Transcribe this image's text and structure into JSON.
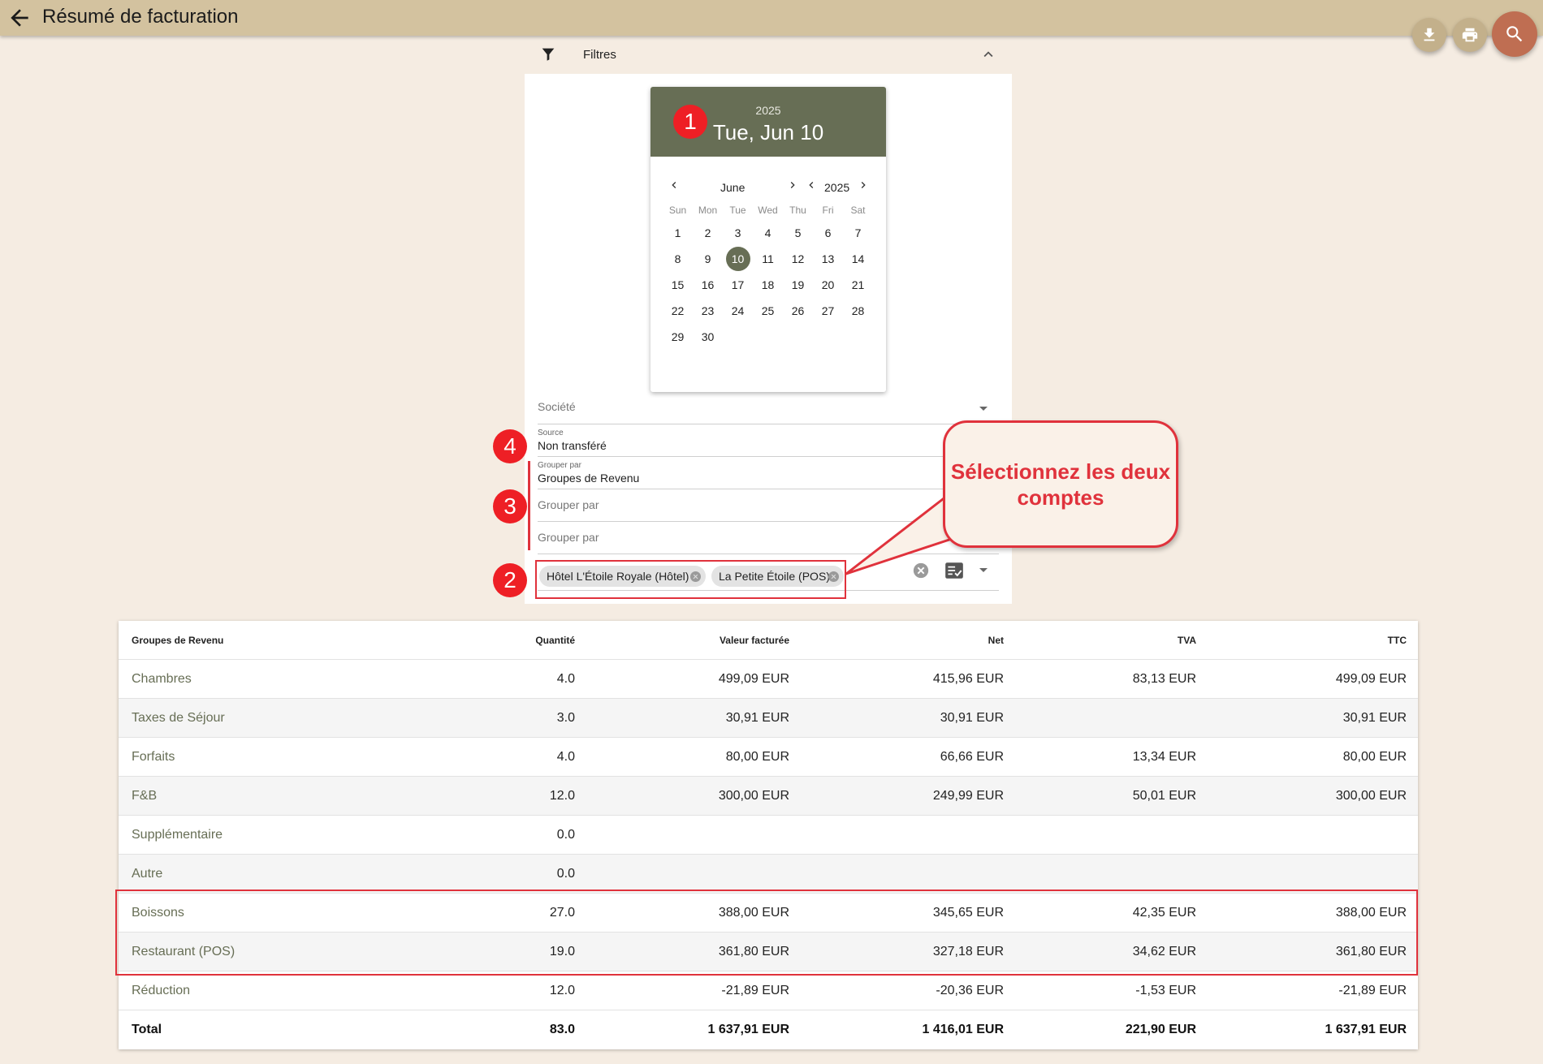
{
  "header": {
    "title": "Résumé de facturation"
  },
  "filters": {
    "label": "Filtres"
  },
  "datepicker": {
    "year": "2025",
    "selected_label": "Tue, Jun 10",
    "month": "June",
    "nav_year": "2025",
    "weekdays": [
      "Sun",
      "Mon",
      "Tue",
      "Wed",
      "Thu",
      "Fri",
      "Sat"
    ],
    "days": [
      "1",
      "2",
      "3",
      "4",
      "5",
      "6",
      "7",
      "8",
      "9",
      "10",
      "11",
      "12",
      "13",
      "14",
      "15",
      "16",
      "17",
      "18",
      "19",
      "20",
      "21",
      "22",
      "23",
      "24",
      "25",
      "26",
      "27",
      "28",
      "29",
      "30"
    ],
    "selected_day": "10"
  },
  "form": {
    "societe_label": "Société",
    "source_label": "Source",
    "source_value": "Non transféré",
    "group1_label": "Grouper par",
    "group1_value": "Groupes de Revenu",
    "group2_placeholder": "Grouper par",
    "group3_placeholder": "Grouper par",
    "accounts": [
      "Hôtel L'Étoile Royale (Hôtel)",
      "La Petite Étoile (POS)"
    ]
  },
  "annotations": {
    "badge1": "1",
    "badge2": "2",
    "badge3": "3",
    "badge4": "4",
    "callout": "Sélectionnez les deux comptes"
  },
  "table": {
    "headers": [
      "Groupes de Revenu",
      "Quantité",
      "Valeur facturée",
      "Net",
      "TVA",
      "TTC"
    ],
    "rows": [
      [
        "Chambres",
        "4.0",
        "499,09 EUR",
        "415,96 EUR",
        "83,13 EUR",
        "499,09 EUR"
      ],
      [
        "Taxes de Séjour",
        "3.0",
        "30,91 EUR",
        "30,91 EUR",
        "",
        "30,91 EUR"
      ],
      [
        "Forfaits",
        "4.0",
        "80,00 EUR",
        "66,66 EUR",
        "13,34 EUR",
        "80,00 EUR"
      ],
      [
        "F&B",
        "12.0",
        "300,00 EUR",
        "249,99 EUR",
        "50,01 EUR",
        "300,00 EUR"
      ],
      [
        "Supplémentaire",
        "0.0",
        "",
        "",
        "",
        ""
      ],
      [
        "Autre",
        "0.0",
        "",
        "",
        "",
        ""
      ],
      [
        "Boissons",
        "27.0",
        "388,00 EUR",
        "345,65 EUR",
        "42,35 EUR",
        "388,00 EUR"
      ],
      [
        "Restaurant (POS)",
        "19.0",
        "361,80 EUR",
        "327,18 EUR",
        "34,62 EUR",
        "361,80 EUR"
      ],
      [
        "Réduction",
        "12.0",
        "-21,89 EUR",
        "-20,36 EUR",
        "-1,53 EUR",
        "-21,89 EUR"
      ]
    ],
    "total": [
      "Total",
      "83.0",
      "1 637,91 EUR",
      "1 416,01 EUR",
      "221,90 EUR",
      "1 637,91 EUR"
    ]
  },
  "colors": {
    "appbar": "#d3c29f",
    "accent": "#676e55",
    "search_fab": "#bf6e52",
    "annotation_red": "#e0323c"
  }
}
